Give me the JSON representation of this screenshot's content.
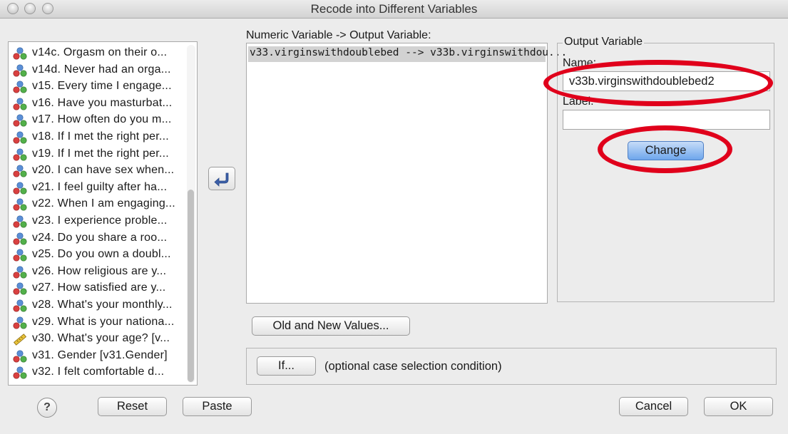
{
  "window": {
    "title": "Recode into Different Variables"
  },
  "variables": [
    {
      "label": "v14c. Orgasm on their o...",
      "type": "nominal"
    },
    {
      "label": "v14d. Never had an orga...",
      "type": "nominal"
    },
    {
      "label": "v15. Every time I engage...",
      "type": "nominal"
    },
    {
      "label": "v16. Have you masturbat...",
      "type": "nominal"
    },
    {
      "label": "v17. How often do you m...",
      "type": "nominal"
    },
    {
      "label": "v18. If I met the right per...",
      "type": "nominal"
    },
    {
      "label": "v19. If I met the right per...",
      "type": "nominal"
    },
    {
      "label": "v20. I can have sex when...",
      "type": "nominal"
    },
    {
      "label": "v21. I feel guilty after ha...",
      "type": "nominal"
    },
    {
      "label": "v22. When I am engaging...",
      "type": "nominal"
    },
    {
      "label": "v23. I experience proble...",
      "type": "nominal"
    },
    {
      "label": "v24. Do you share a roo...",
      "type": "nominal"
    },
    {
      "label": "v25. Do you own a doubl...",
      "type": "nominal"
    },
    {
      "label": "v26. How religious are y...",
      "type": "nominal"
    },
    {
      "label": "v27. How satisfied are y...",
      "type": "nominal"
    },
    {
      "label": "v28. What's your monthly...",
      "type": "nominal"
    },
    {
      "label": "v29. What is your nationa...",
      "type": "nominal"
    },
    {
      "label": "v30. What's your age? [v...",
      "type": "scale"
    },
    {
      "label": "v31. Gender [v31.Gender]",
      "type": "nominal"
    },
    {
      "label": "v32. I felt comfortable d...",
      "type": "nominal"
    }
  ],
  "mapping": {
    "header": "Numeric Variable -> Output Variable:",
    "rows": [
      "v33.virginswithdoublebed --> v33b.virginswithdou..."
    ]
  },
  "output_variable": {
    "legend": "Output Variable",
    "name_label": "Name:",
    "name_value": "v33b.virginswithdoublebed2",
    "label_label": "Label:",
    "label_value": "",
    "change_button": "Change"
  },
  "buttons": {
    "old_new_values": "Old and New Values...",
    "if": "If...",
    "if_note": "(optional case selection condition)",
    "help": "?",
    "reset": "Reset",
    "paste": "Paste",
    "cancel": "Cancel",
    "ok": "OK"
  },
  "colors": {
    "annotation": "#e0001b",
    "selection": "#d2d2d2",
    "change_button": "#6ea6ec"
  }
}
